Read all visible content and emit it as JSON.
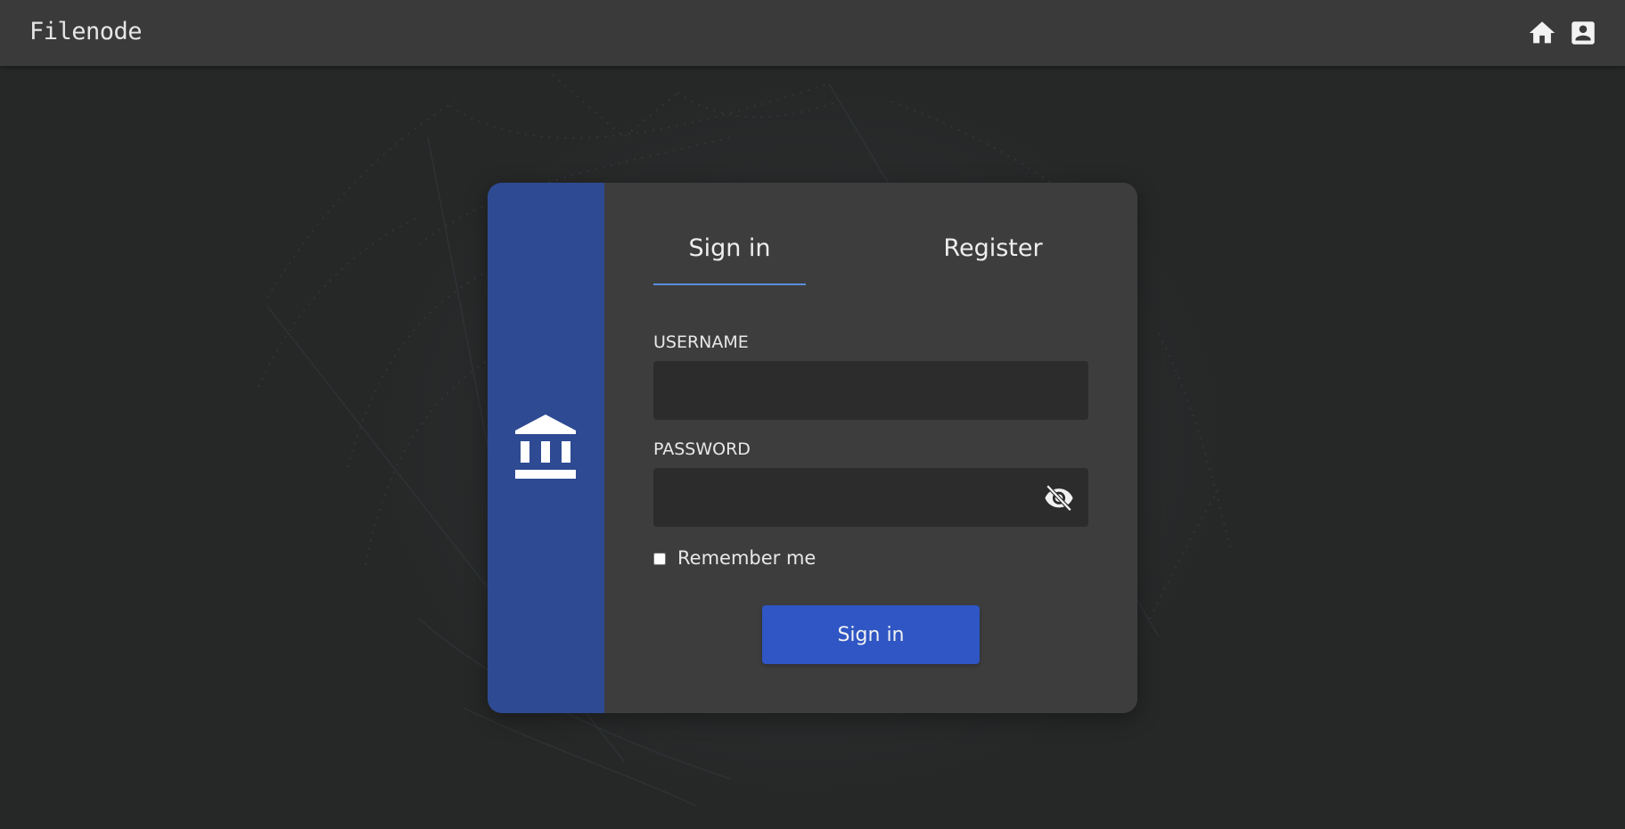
{
  "app": {
    "brand": "Filenode"
  },
  "topbar": {
    "icons": [
      "home-icon",
      "account-box-icon"
    ]
  },
  "auth": {
    "tabs": [
      {
        "label": "Sign in",
        "active": true
      },
      {
        "label": "Register",
        "active": false
      }
    ],
    "username": {
      "label": "USERNAME",
      "value": "",
      "placeholder": ""
    },
    "password": {
      "label": "PASSWORD",
      "value": "",
      "placeholder": "",
      "toggle_icon": "eye-off-icon"
    },
    "remember": {
      "label": "Remember me",
      "checked": false
    },
    "submit_label": "Sign in",
    "side_icon": "bank-icon"
  },
  "colors": {
    "topbar": "#3a3a3a",
    "card": "#3d3d3d",
    "card_side": "#2e4a92",
    "tab_underline": "#5a8fdc",
    "input_bg": "#2c2c2c",
    "primary_button": "#2f56c4"
  }
}
